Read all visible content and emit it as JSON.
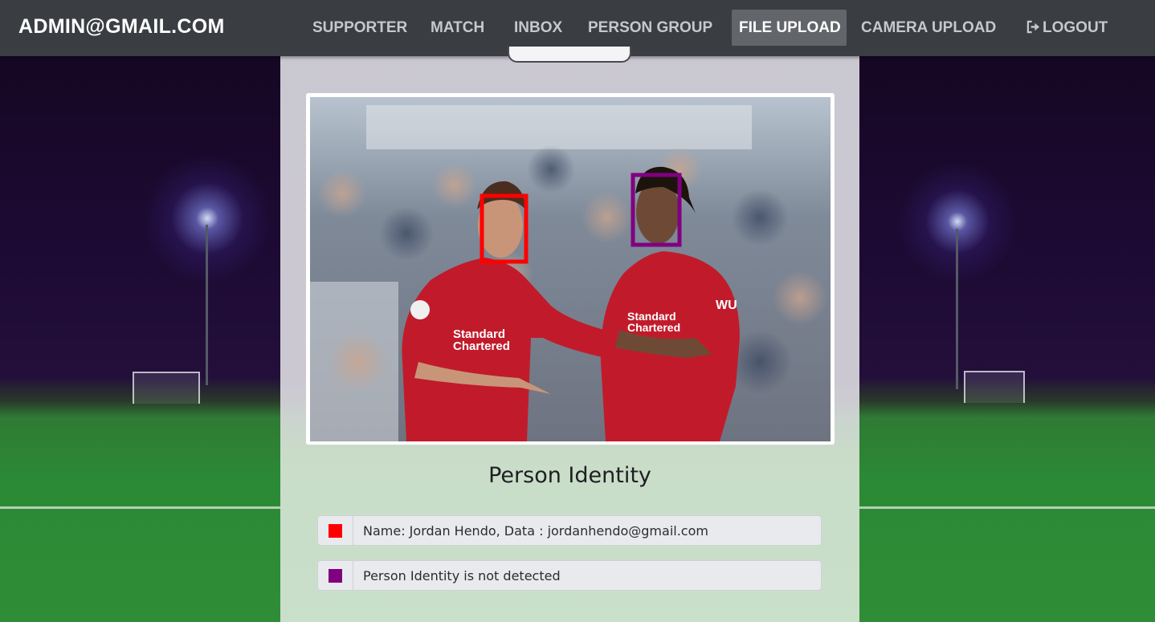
{
  "navbar": {
    "brand": "ADMIN@GMAIL.COM",
    "items": [
      {
        "label": "SUPPORTER"
      },
      {
        "label": "MATCH"
      },
      {
        "label": "INBOX"
      },
      {
        "label": "PERSON GROUP"
      },
      {
        "label": "FILE UPLOAD",
        "active": true
      },
      {
        "label": "CAMERA UPLOAD"
      },
      {
        "label": "LOGOUT",
        "icon": "logout-icon"
      }
    ]
  },
  "upload": {
    "image_alt": "uploaded-photo",
    "detections": [
      {
        "color": "#ff0000",
        "label": "face-box-red"
      },
      {
        "color": "#800080",
        "label": "face-box-purple"
      }
    ]
  },
  "identity": {
    "title": "Person Identity",
    "rows": [
      {
        "color": "#ff0000",
        "text": "Name: Jordan Hendo, Data : jordanhendo@gmail.com"
      },
      {
        "color": "#800080",
        "text": "Person Identity is not detected"
      }
    ]
  },
  "colors": {
    "navbar_bg": "#3a3d42",
    "active_tab_bg": "#62656a",
    "detection_red": "#ff0000",
    "detection_purple": "#800080"
  }
}
